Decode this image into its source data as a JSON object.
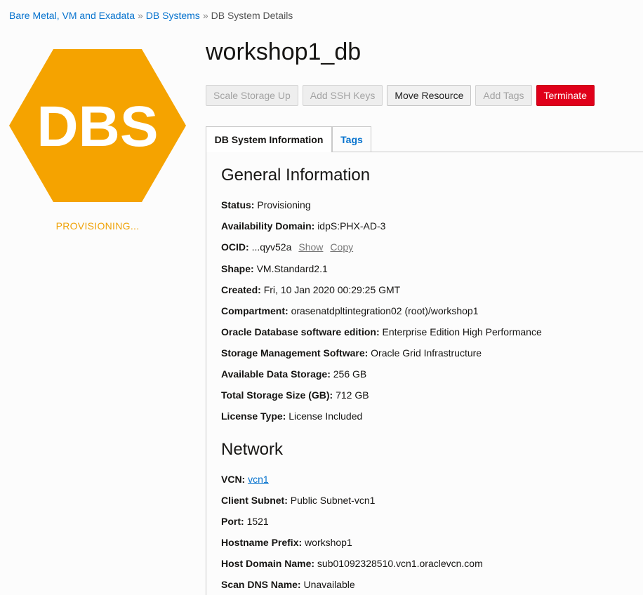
{
  "breadcrumb": {
    "items": [
      "Bare Metal, VM and Exadata",
      "DB Systems"
    ],
    "current": "DB System Details",
    "separator": "»"
  },
  "hero": {
    "badge_text": "DBS",
    "badge_color": "#f5a300",
    "status": "PROVISIONING..."
  },
  "title": "workshop1_db",
  "actions": {
    "scale_storage": "Scale Storage Up",
    "add_ssh_keys": "Add SSH Keys",
    "move_resource": "Move Resource",
    "add_tags": "Add Tags",
    "terminate": "Terminate"
  },
  "tabs": {
    "info": "DB System Information",
    "tags": "Tags"
  },
  "general": {
    "title": "General Information",
    "status": {
      "label": "Status:",
      "value": "Provisioning"
    },
    "ad": {
      "label": "Availability Domain:",
      "value": "idpS:PHX-AD-3"
    },
    "ocid": {
      "label": "OCID:",
      "value": "...qyv52a",
      "show": "Show",
      "copy": "Copy"
    },
    "shape": {
      "label": "Shape:",
      "value": "VM.Standard2.1"
    },
    "created": {
      "label": "Created:",
      "value": "Fri, 10 Jan 2020 00:29:25 GMT"
    },
    "compartment": {
      "label": "Compartment:",
      "value": "orasenatdpltintegration02 (root)/workshop1"
    },
    "edition": {
      "label": "Oracle Database software edition:",
      "value": "Enterprise Edition High Performance"
    },
    "storage_mgmt": {
      "label": "Storage Management Software:",
      "value": "Oracle Grid Infrastructure"
    },
    "data_storage": {
      "label": "Available Data Storage:",
      "value": "256 GB"
    },
    "total_storage": {
      "label": "Total Storage Size (GB):",
      "value": "712 GB"
    },
    "license": {
      "label": "License Type:",
      "value": "License Included"
    }
  },
  "network": {
    "title": "Network",
    "vcn": {
      "label": "VCN:",
      "value": "vcn1"
    },
    "subnet": {
      "label": "Client Subnet:",
      "value": "Public Subnet-vcn1"
    },
    "port": {
      "label": "Port:",
      "value": "1521"
    },
    "hostname": {
      "label": "Hostname Prefix:",
      "value": "workshop1"
    },
    "domain": {
      "label": "Host Domain Name:",
      "value": "sub01092328510.vcn1.oraclevcn.com"
    },
    "scan": {
      "label": "Scan DNS Name:",
      "value": "Unavailable"
    }
  }
}
